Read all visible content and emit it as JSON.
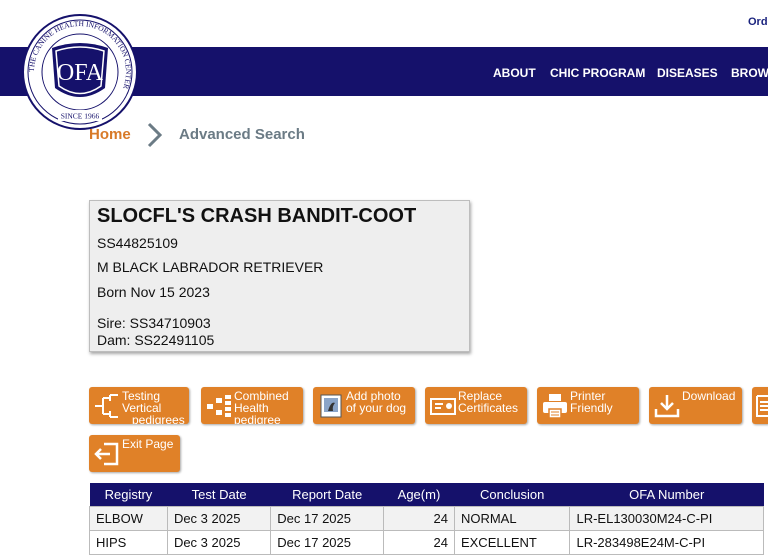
{
  "header": {
    "top_link": "Orde",
    "logo_text": "OFA",
    "logo_ring_text": "THE CANINE HEALTH INFORMATION CENTER",
    "logo_since": "SINCE 1966",
    "nav": [
      "ABOUT",
      "CHIC PROGRAM",
      "DISEASES",
      "BROW"
    ]
  },
  "breadcrumb": {
    "home": "Home",
    "current": "Advanced Search"
  },
  "dog": {
    "name": "SLOCFL'S CRASH BANDIT-COOT",
    "registration": "SS44825109",
    "description": "M BLACK LABRADOR RETRIEVER",
    "born": "Born Nov 15 2023",
    "sire": "Sire: SS34710903",
    "dam": "Dam: SS22491105"
  },
  "buttons": {
    "testing": "Testing\nVertical\n   pedigrees",
    "combined": "Combined\nHealth\npedigree",
    "add_photo": "Add photo\nof your dog",
    "replace": "Replace\nCertificates",
    "printer": "Printer\nFriendly",
    "download": "Download",
    "exit": "Exit Page"
  },
  "table": {
    "headers": [
      "Registry",
      "Test Date",
      "Report Date",
      "Age(m)",
      "Conclusion",
      "OFA Number"
    ],
    "rows": [
      [
        "ELBOW",
        "Dec 3 2025",
        "Dec 17 2025",
        "24",
        "NORMAL",
        "LR-EL130030M24-C-PI"
      ],
      [
        "HIPS",
        "Dec 3 2025",
        "Dec 17 2025",
        "24",
        "EXCELLENT",
        "LR-283498E24M-C-PI"
      ]
    ]
  },
  "colors": {
    "navy": "#15116b",
    "orange": "#e08128",
    "breadcrumb_home": "#d87a28"
  }
}
